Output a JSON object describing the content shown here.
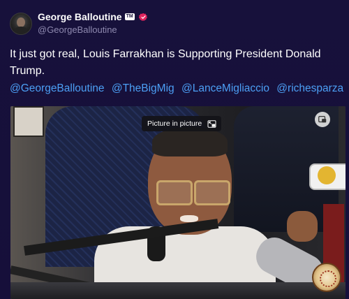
{
  "post": {
    "author_name": "George Balloutine",
    "author_badge": "TM",
    "author_handle": "@GeorgeBalloutine",
    "text": "It just got real,  Louis Farrakhan is Supporting President Donald Trump.",
    "mentions": [
      "@GeorgeBalloutine",
      "@TheBigMig",
      "@LanceMigliaccio",
      "@richesparza"
    ],
    "verified_icon": "verified-badge-icon",
    "colors": {
      "background": "#16103a",
      "mention": "#4c9ff5",
      "verified": "#e0245e",
      "handle": "#8f8ab0"
    }
  },
  "video": {
    "pip_tooltip": "Picture in picture",
    "pip_icon": "picture-in-picture-icon",
    "corner_icon": "picture-in-picture-icon"
  }
}
